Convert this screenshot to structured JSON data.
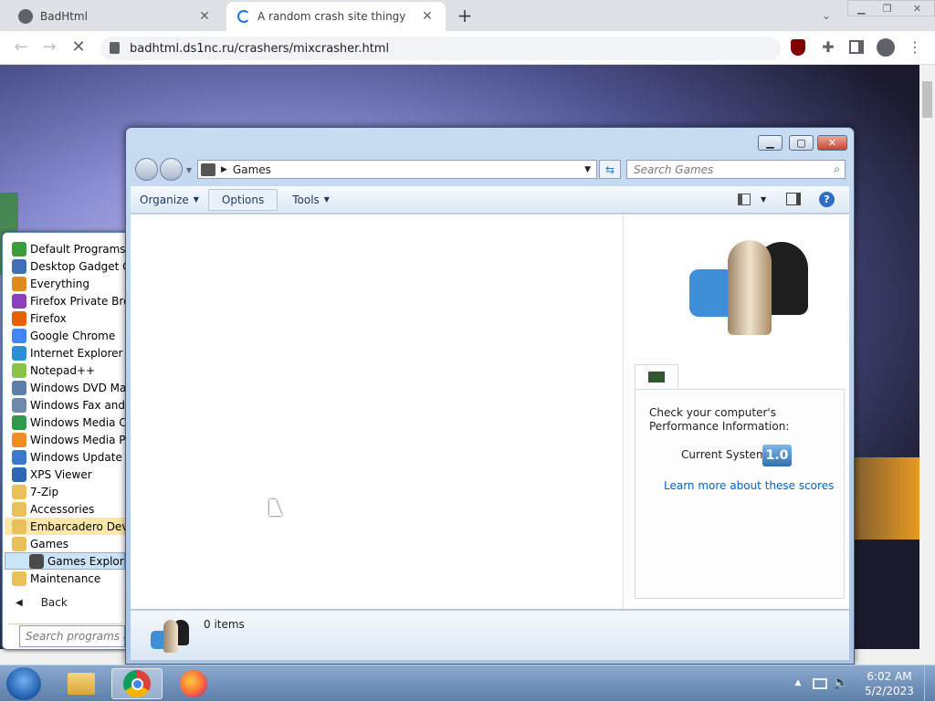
{
  "browser": {
    "tabs": [
      {
        "title": "BadHtml",
        "close": "✕"
      },
      {
        "title": "A random crash site thingy",
        "close": "✕"
      }
    ],
    "new_tab": "+",
    "url": "badhtml.ds1nc.ru/crashers/mixcrasher.html"
  },
  "start_menu": {
    "programs": [
      {
        "label": "Default Programs",
        "icon": "#3c9c3c"
      },
      {
        "label": "Desktop Gadget Gallery",
        "icon": "#3f6fb5"
      },
      {
        "label": "Everything",
        "icon": "#e08a1e"
      },
      {
        "label": "Firefox Private Browsing",
        "icon": "#8b3fb8"
      },
      {
        "label": "Firefox",
        "icon": "#e66000"
      },
      {
        "label": "Google Chrome",
        "icon": "#4285f4"
      },
      {
        "label": "Internet Explorer",
        "icon": "#2a8fd6"
      },
      {
        "label": "Notepad++",
        "icon": "#8bc34a"
      },
      {
        "label": "Windows DVD Maker",
        "icon": "#5c7ea8"
      },
      {
        "label": "Windows Fax and Scan",
        "icon": "#6f8aa8"
      },
      {
        "label": "Windows Media Center",
        "icon": "#2e9a4a"
      },
      {
        "label": "Windows Media Player",
        "icon": "#ef8d22"
      },
      {
        "label": "Windows Update",
        "icon": "#3a79c9"
      },
      {
        "label": "XPS Viewer",
        "icon": "#2e67b1"
      },
      {
        "label": "7-Zip",
        "icon": "#e8c15a"
      },
      {
        "label": "Accessories",
        "icon": "#e8c15a"
      },
      {
        "label": "Embarcadero Dev-C++",
        "icon": "#e8c15a"
      },
      {
        "label": "Games",
        "icon": "#e8c15a"
      },
      {
        "label": "Games Explorer",
        "icon": "#4a4a4a"
      },
      {
        "label": "Maintenance",
        "icon": "#e8c15a"
      }
    ],
    "back": "Back",
    "search_placeholder": "Search programs and files"
  },
  "explorer": {
    "breadcrumb": "Games",
    "search_placeholder": "Search Games",
    "commands": {
      "organize": "Organize",
      "options": "Options",
      "tools": "Tools"
    },
    "preview": {
      "heading": "Check your computer's Performance Information:",
      "score_label": "Current System",
      "score_value": "1.0",
      "link": "Learn more about these scores"
    },
    "status": "0 items"
  },
  "taskbar": {
    "time": "6:02 AM",
    "date": "5/2/2023"
  },
  "colors": {
    "accent": "#1a73e8",
    "link": "#0066cc",
    "score": "#2f6fb0"
  }
}
